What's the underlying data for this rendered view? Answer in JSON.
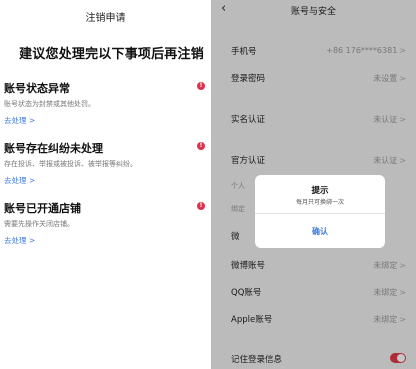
{
  "left": {
    "title": "注销申请",
    "headline": "建议您处理完以下事项后再注销",
    "issues": [
      {
        "heading": "账号状态异常",
        "desc": "账号状态为封禁或其他处罚。",
        "action": "去处理 >",
        "badge": "!"
      },
      {
        "heading": "账号存在纠纷未处理",
        "desc": "存在投诉、举报或被投诉、被举报等纠纷。",
        "action": "去处理 >",
        "badge": "!"
      },
      {
        "heading": "账号已开通店铺",
        "desc": "需要先操作关闭店铺。",
        "action": "去处理 >",
        "badge": "!"
      }
    ]
  },
  "right": {
    "back_icon": "‹",
    "title": "账号与安全",
    "rows": [
      {
        "label": "手机号",
        "value": "+86 176****6381",
        "chevron": ">"
      },
      {
        "label": "登录密码",
        "value": "未设置",
        "chevron": ">"
      },
      {
        "label": "实名认证",
        "value": "未认证",
        "chevron": ">"
      },
      {
        "label": "官方认证",
        "value": "未认证",
        "chevron": ">"
      },
      {
        "label": "微",
        "value": "",
        "chevron": ""
      },
      {
        "label": "微博账号",
        "value": "未绑定",
        "chevron": ">"
      },
      {
        "label": "QQ账号",
        "value": "未绑定",
        "chevron": ">"
      },
      {
        "label": "Apple账号",
        "value": "未绑定",
        "chevron": ">"
      },
      {
        "label": "记住登录信息",
        "value": "",
        "chevron": ""
      }
    ],
    "partial_hint_1": "个人",
    "partial_hint_2": "绑定",
    "toggle_on": true,
    "accent": "#e23848"
  },
  "dialog": {
    "title": "提示",
    "message": "每月只可换绑一次",
    "confirm": "确认",
    "confirm_color": "#3d7be0"
  }
}
